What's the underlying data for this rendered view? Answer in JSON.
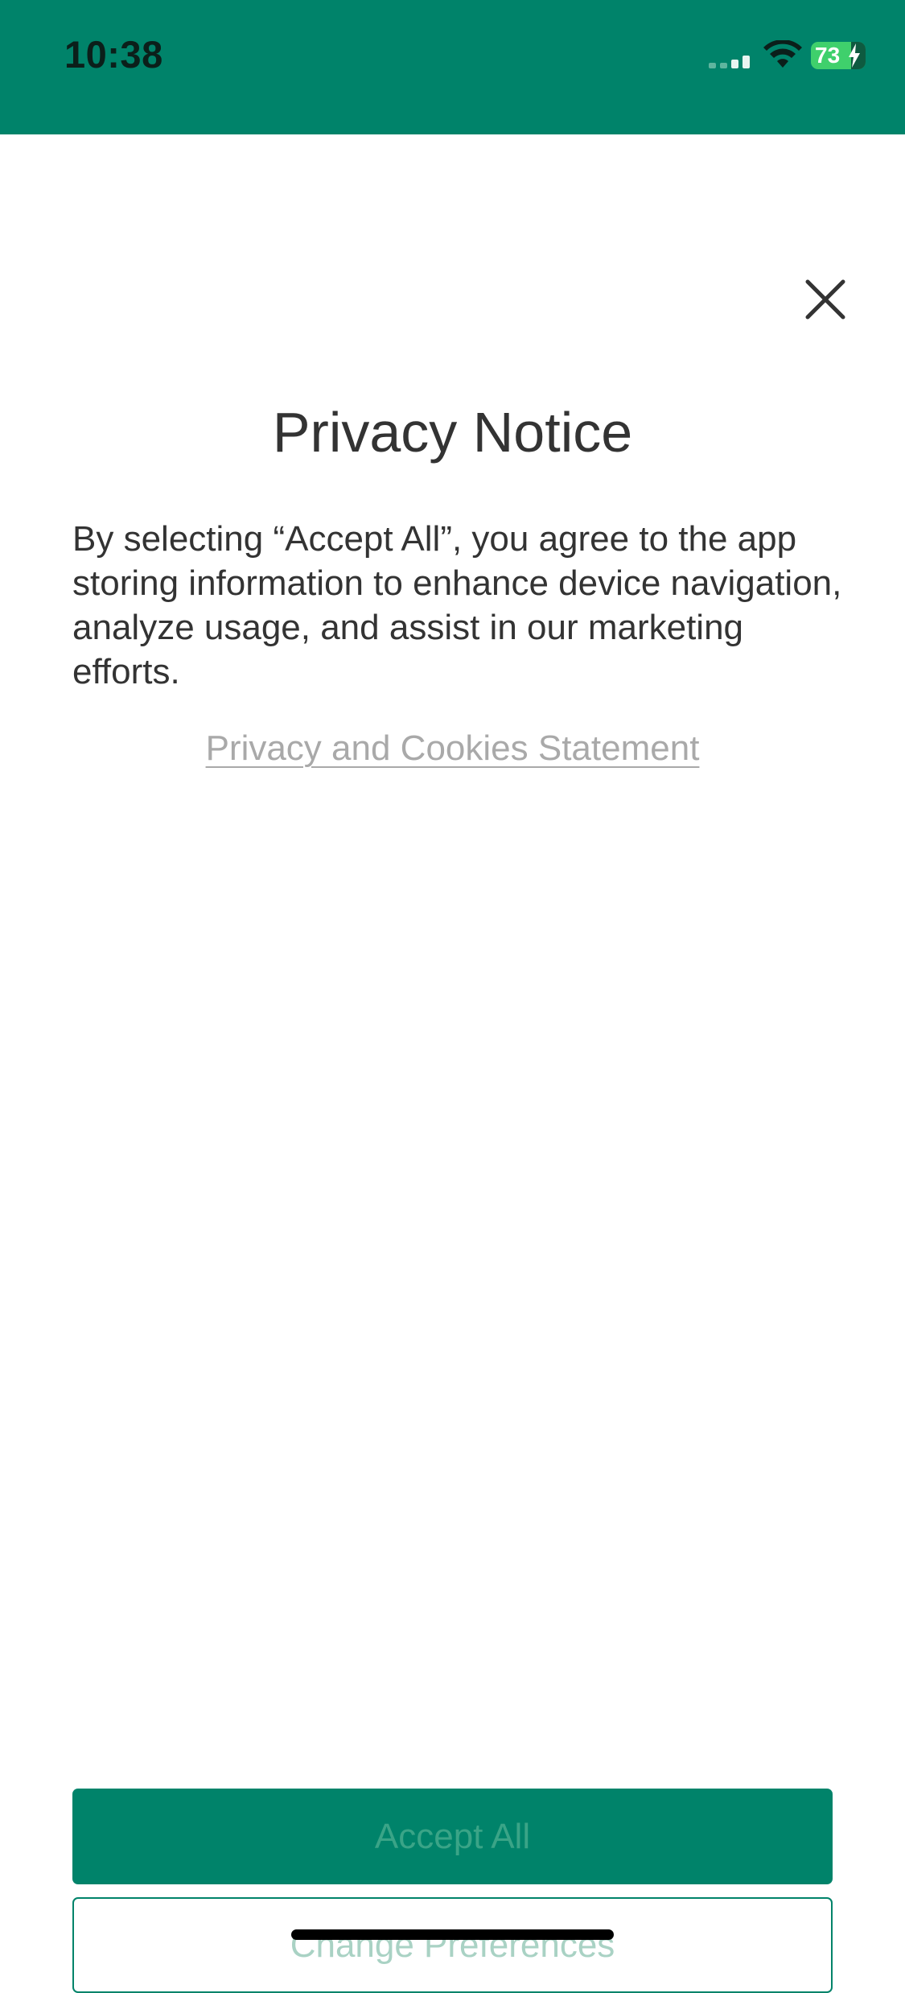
{
  "status_bar": {
    "time": "10:38",
    "battery_level": "73",
    "background_color": "#00836A",
    "icons": [
      "signal-icon",
      "wifi-icon",
      "battery-icon",
      "charging-bolt-icon"
    ]
  },
  "dialog": {
    "close_icon": "close-icon",
    "title": "Privacy Notice",
    "body": "By selecting “Accept All”, you agree to the app storing information to enhance device navigation, analyze usage, and assist in our marketing efforts.",
    "link_label": "Privacy and Cookies Statement"
  },
  "actions": {
    "accept_all_label": "Accept All",
    "change_preferences_label": "Change Preferences"
  },
  "colors": {
    "brand": "#00836A",
    "text": "#333333",
    "link": "#a9a9a9"
  }
}
